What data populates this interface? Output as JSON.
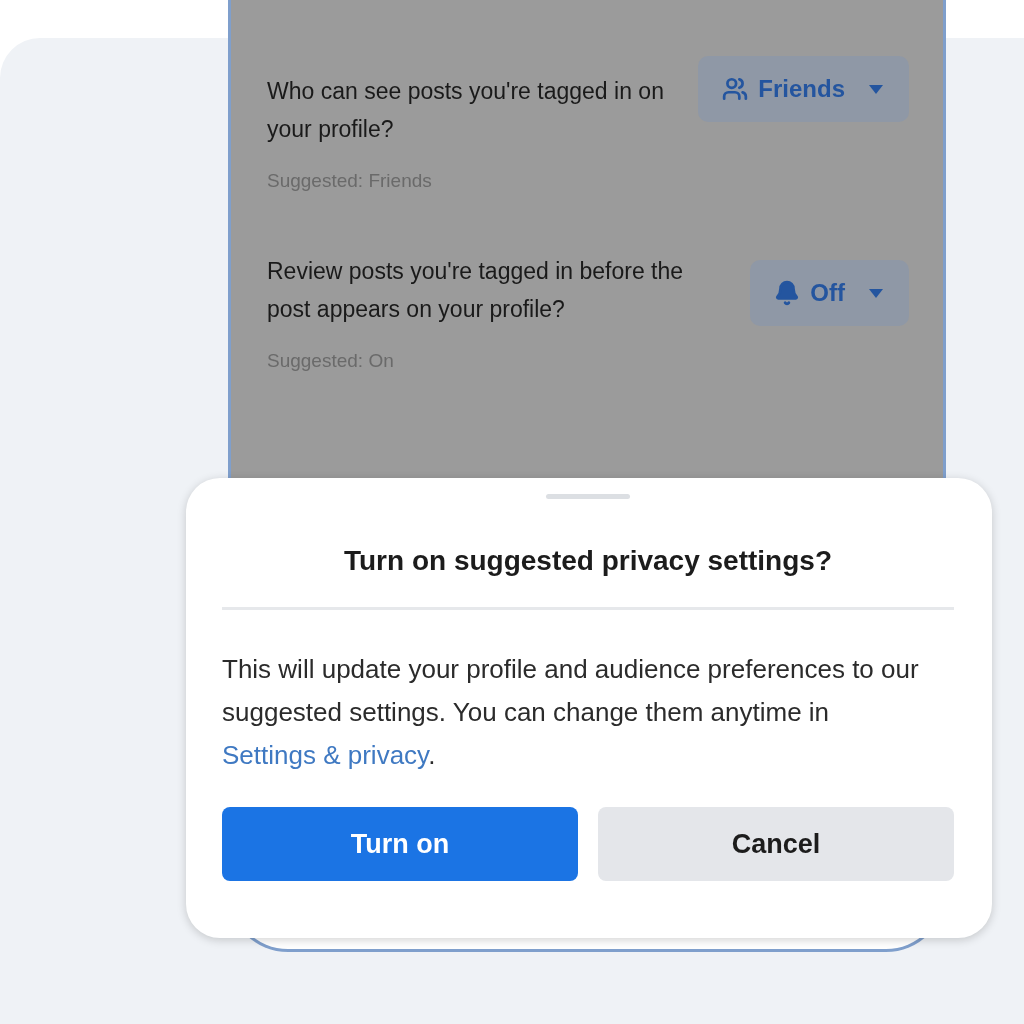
{
  "settings": [
    {
      "question": "Who can see posts you're tagged in on your profile?",
      "suggested": "Suggested: Friends",
      "control": {
        "label": "Friends",
        "kind": "people"
      }
    },
    {
      "question": "Review posts you're tagged in before the post appears on your profile?",
      "suggested": "Suggested: On",
      "control": {
        "label": "Off",
        "kind": "bell"
      }
    }
  ],
  "sheet": {
    "title": "Turn on suggested privacy settings?",
    "body_before": "This will update your profile and audience preferences to our suggested settings. You can change them anytime in ",
    "link": "Settings & privacy",
    "body_after": ".",
    "buttons": [
      {
        "label": "Turn on",
        "kind": "primary"
      },
      {
        "label": "Cancel",
        "kind": "secondary"
      }
    ]
  }
}
